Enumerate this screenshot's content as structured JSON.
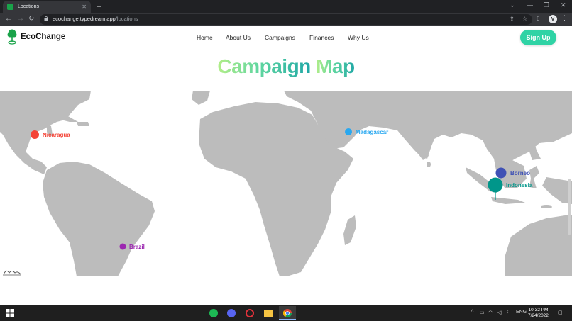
{
  "browser": {
    "tab_title": "Locations",
    "url_host": "ecochange.typedream.app",
    "url_path": "/locations",
    "profile_initial": "V"
  },
  "site": {
    "logo": "EcoChange",
    "nav": [
      "Home",
      "About Us",
      "Campaigns",
      "Finances",
      "Why Us"
    ],
    "signup": "Sign Up",
    "brand_color": "#2fd3a5"
  },
  "page": {
    "title_part1": "Campaign",
    "title_part2": "Map"
  },
  "map": {
    "land_color": "#bcbcbc",
    "markers": [
      {
        "name": "Nicaragua",
        "color": "#f44336",
        "size": "medium"
      },
      {
        "name": "Madagascar",
        "color": "#29a8f0",
        "size": "small"
      },
      {
        "name": "Borneo",
        "color": "#3f51b5",
        "size": "medium"
      },
      {
        "name": "Indonesia",
        "color": "#00968a",
        "size": "large"
      },
      {
        "name": "Brazil",
        "color": "#9c27b0",
        "size": "small"
      }
    ]
  },
  "taskbar": {
    "language": "ENG",
    "time": "10:32 PM",
    "date": "7/24/2022"
  }
}
